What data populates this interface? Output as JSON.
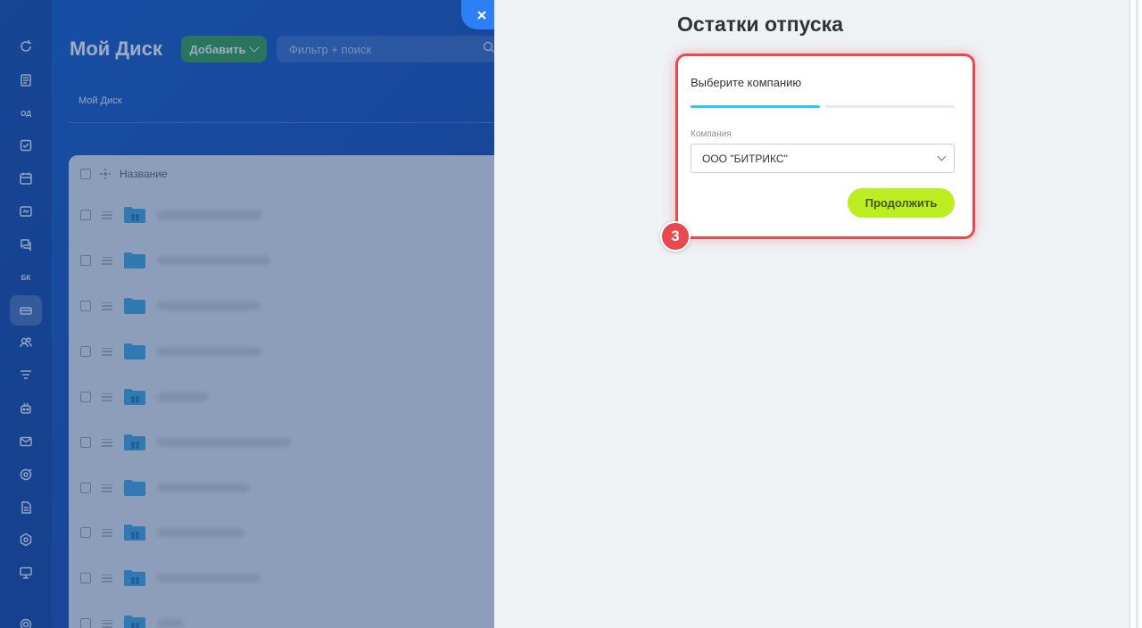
{
  "background": {
    "page_title": "Мой Диск",
    "add_button_label": "Добавить",
    "filter_placeholder": "Фильтр + поиск",
    "breadcrumb": "Мой Диск",
    "table_header_name": "Название",
    "rail_badges": {
      "od": "ОД",
      "bk": "БК"
    }
  },
  "slider": {
    "title": "Остатки отпуска",
    "card_heading": "Выберите компанию",
    "field_label": "Компания",
    "selected_company": "ООО \"БИТРИКС\"",
    "continue_label": "Продолжить",
    "step_number": "3",
    "progress_steps": 2,
    "progress_current": 1
  },
  "colors": {
    "highlight": "#e8494f",
    "progress_active": "#2fc6f6",
    "continue_button": "#bbed21",
    "add_button": "#2e9a48",
    "close_button": "#2d7ff5"
  }
}
